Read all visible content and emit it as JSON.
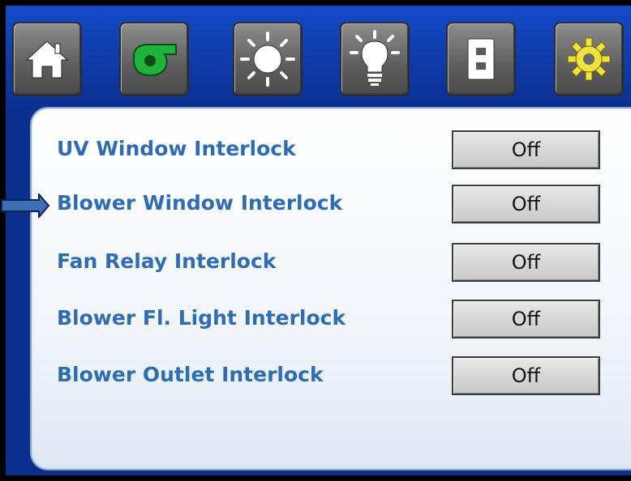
{
  "toolbar": {
    "tabs": [
      {
        "icon": "home-icon"
      },
      {
        "icon": "blower-icon",
        "color": "#1fb33a"
      },
      {
        "icon": "uv-sun-icon"
      },
      {
        "icon": "light-bulb-icon"
      },
      {
        "icon": "outlet-icon"
      },
      {
        "icon": "gear-icon",
        "color": "#f2e23a",
        "selected": true
      }
    ]
  },
  "interlocks": {
    "selected_index": 1,
    "rows": [
      {
        "label": "UV Window Interlock",
        "value": "Off"
      },
      {
        "label": "Blower Window Interlock",
        "value": "Off"
      },
      {
        "label": "Fan Relay Interlock",
        "value": "Off"
      },
      {
        "label": "Blower Fl. Light Interlock",
        "value": "Off"
      },
      {
        "label": "Blower Outlet Interlock",
        "value": "Off"
      }
    ]
  },
  "colors": {
    "frame": "#0a2f8e",
    "label": "#2e6db3",
    "selection_arrow": "#3d6fb8"
  }
}
